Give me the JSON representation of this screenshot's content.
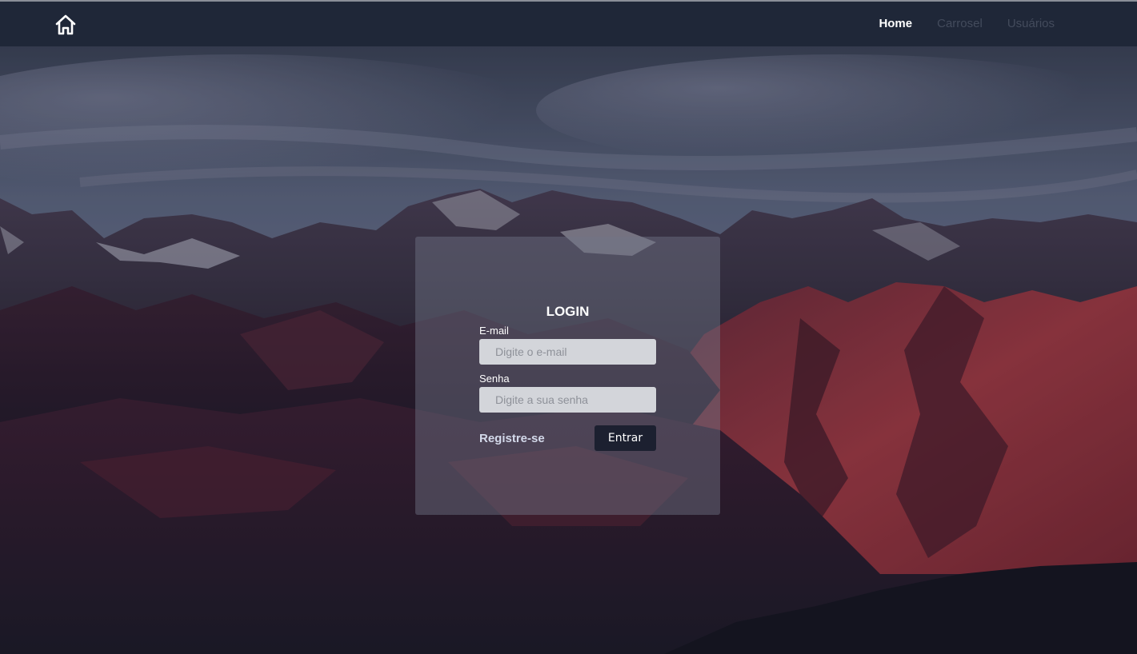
{
  "nav": {
    "home_icon": "home-icon",
    "links": [
      {
        "label": "Home",
        "active": true
      },
      {
        "label": "Carrosel",
        "active": false
      },
      {
        "label": "Usuários",
        "active": false
      }
    ]
  },
  "login": {
    "title": "LOGIN",
    "email_label": "E-mail",
    "email_placeholder": "Digite o e-mail",
    "email_value": "",
    "password_label": "Senha",
    "password_placeholder": "Digite a sua senha",
    "password_value": "",
    "register_label": "Registre-se",
    "submit_label": "Entrar"
  },
  "colors": {
    "navbar": "#1f2738",
    "button": "#1c2030",
    "input": "#d3d5da",
    "nav_muted": "#434b5c"
  }
}
